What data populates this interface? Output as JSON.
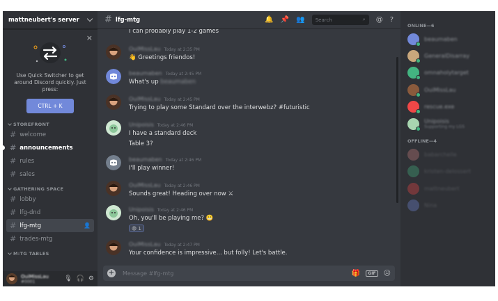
{
  "server": {
    "name": "mattneubert's server"
  },
  "quick_switcher": {
    "text": "Use Quick Switcher to get around Discord quickly. Just press:",
    "button": "CTRL + K",
    "close": "×"
  },
  "categories": {
    "storefront": "STOREFRONT",
    "gathering": "GATHERING SPACE",
    "mtg_tables": "M:TG TABLES"
  },
  "channels": {
    "welcome": "welcome",
    "announcements": "announcements",
    "rules": "rules",
    "sales": "sales",
    "lobby": "lobby",
    "lfg_dnd": "lfg-dnd",
    "lfg_mtg": "lfg-mtg",
    "trades_mtg": "trades-mtg"
  },
  "user_panel": {
    "username": "OuiMissLau",
    "discriminator": "#0001"
  },
  "chat": {
    "channel": "lfg-mtg",
    "search_placeholder": "Search",
    "composer_placeholder": "Message #lfg-mtg",
    "gif": "GIF"
  },
  "messages": [
    {
      "text": "I can probably play 1-2 games"
    },
    {
      "author": "OuiMissLau",
      "time": "Today at 2:35 PM",
      "text": "Greetings friendos!",
      "emoji": "👋"
    },
    {
      "author": "beaumaben",
      "time": "Today at 2:45 PM",
      "text": "What's up",
      "blur_tail": "beaumaben"
    },
    {
      "author": "OuiMissLau",
      "time": "Today at 2:45 PM",
      "text": "Trying to play some Standard over the interwebz? #futuristic"
    },
    {
      "author": "Unipoisis",
      "time": "Today at 2:46 PM",
      "text": "I have a standard deck",
      "text2": "Table 3?"
    },
    {
      "author": "beaumaben",
      "time": "Today at 2:46 PM",
      "text": "I'll play winner!"
    },
    {
      "author": "OuiMissLau",
      "time": "Today at 2:46 PM",
      "text": "Sounds great! Heading over now",
      "emoji": "⚔"
    },
    {
      "author": "Unipoisis",
      "time": "Today at 2:46 PM",
      "text": "Oh, you'll be playing me?",
      "emoji": "😬",
      "reaction": {
        "emoji": "😄",
        "count": "1"
      }
    },
    {
      "author": "OuiMissLau",
      "time": "Today at 2:47 PM",
      "text": "Your confidence is impressive... but folly! Let's battle."
    }
  ],
  "members": {
    "online_header": "ONLINE—6",
    "offline_header": "OFFLINE—4",
    "online": [
      {
        "name": "beaumaben",
        "color": "#7289da",
        "status": "#43b581"
      },
      {
        "name": "GeneralDisarray",
        "color": "#c9a77c",
        "status": "#43b581"
      },
      {
        "name": "omnaholytarget",
        "color": "#43b581",
        "status": "#43b581"
      },
      {
        "name": "OuiMissLau",
        "color": "#8a5a3c",
        "status": "#43b581"
      },
      {
        "name": "rescue.exe",
        "color": "#f04747",
        "status": "#43b581"
      },
      {
        "name": "Unipoisis",
        "activity": "Supporting my LGS",
        "color": "#a8d5b0",
        "status": "#43b581"
      }
    ],
    "offline": [
      {
        "name": "babarchelle",
        "color": "#c97f7f"
      },
      {
        "name": "kristen-delossert",
        "color": "#43b581"
      },
      {
        "name": "mattneubert",
        "color": "#f04747"
      },
      {
        "name": "Nina",
        "color": "#7289da"
      }
    ]
  }
}
